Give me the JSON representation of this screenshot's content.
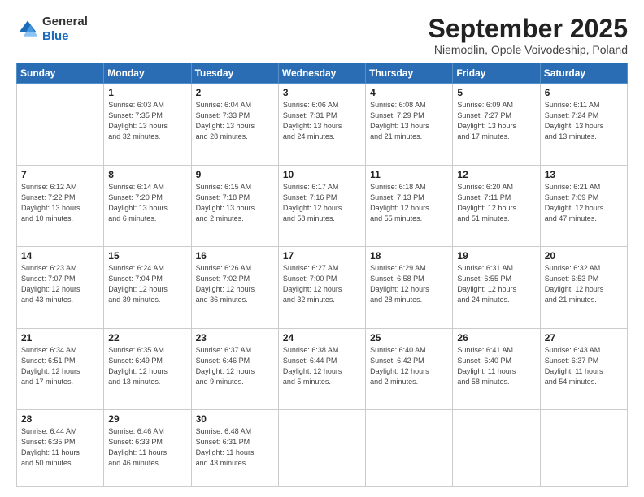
{
  "logo": {
    "general": "General",
    "blue": "Blue"
  },
  "header": {
    "month": "September 2025",
    "location": "Niemodlin, Opole Voivodeship, Poland"
  },
  "weekdays": [
    "Sunday",
    "Monday",
    "Tuesday",
    "Wednesday",
    "Thursday",
    "Friday",
    "Saturday"
  ],
  "weeks": [
    [
      {
        "day": "",
        "info": ""
      },
      {
        "day": "1",
        "info": "Sunrise: 6:03 AM\nSunset: 7:35 PM\nDaylight: 13 hours\nand 32 minutes."
      },
      {
        "day": "2",
        "info": "Sunrise: 6:04 AM\nSunset: 7:33 PM\nDaylight: 13 hours\nand 28 minutes."
      },
      {
        "day": "3",
        "info": "Sunrise: 6:06 AM\nSunset: 7:31 PM\nDaylight: 13 hours\nand 24 minutes."
      },
      {
        "day": "4",
        "info": "Sunrise: 6:08 AM\nSunset: 7:29 PM\nDaylight: 13 hours\nand 21 minutes."
      },
      {
        "day": "5",
        "info": "Sunrise: 6:09 AM\nSunset: 7:27 PM\nDaylight: 13 hours\nand 17 minutes."
      },
      {
        "day": "6",
        "info": "Sunrise: 6:11 AM\nSunset: 7:24 PM\nDaylight: 13 hours\nand 13 minutes."
      }
    ],
    [
      {
        "day": "7",
        "info": "Sunrise: 6:12 AM\nSunset: 7:22 PM\nDaylight: 13 hours\nand 10 minutes."
      },
      {
        "day": "8",
        "info": "Sunrise: 6:14 AM\nSunset: 7:20 PM\nDaylight: 13 hours\nand 6 minutes."
      },
      {
        "day": "9",
        "info": "Sunrise: 6:15 AM\nSunset: 7:18 PM\nDaylight: 13 hours\nand 2 minutes."
      },
      {
        "day": "10",
        "info": "Sunrise: 6:17 AM\nSunset: 7:16 PM\nDaylight: 12 hours\nand 58 minutes."
      },
      {
        "day": "11",
        "info": "Sunrise: 6:18 AM\nSunset: 7:13 PM\nDaylight: 12 hours\nand 55 minutes."
      },
      {
        "day": "12",
        "info": "Sunrise: 6:20 AM\nSunset: 7:11 PM\nDaylight: 12 hours\nand 51 minutes."
      },
      {
        "day": "13",
        "info": "Sunrise: 6:21 AM\nSunset: 7:09 PM\nDaylight: 12 hours\nand 47 minutes."
      }
    ],
    [
      {
        "day": "14",
        "info": "Sunrise: 6:23 AM\nSunset: 7:07 PM\nDaylight: 12 hours\nand 43 minutes."
      },
      {
        "day": "15",
        "info": "Sunrise: 6:24 AM\nSunset: 7:04 PM\nDaylight: 12 hours\nand 39 minutes."
      },
      {
        "day": "16",
        "info": "Sunrise: 6:26 AM\nSunset: 7:02 PM\nDaylight: 12 hours\nand 36 minutes."
      },
      {
        "day": "17",
        "info": "Sunrise: 6:27 AM\nSunset: 7:00 PM\nDaylight: 12 hours\nand 32 minutes."
      },
      {
        "day": "18",
        "info": "Sunrise: 6:29 AM\nSunset: 6:58 PM\nDaylight: 12 hours\nand 28 minutes."
      },
      {
        "day": "19",
        "info": "Sunrise: 6:31 AM\nSunset: 6:55 PM\nDaylight: 12 hours\nand 24 minutes."
      },
      {
        "day": "20",
        "info": "Sunrise: 6:32 AM\nSunset: 6:53 PM\nDaylight: 12 hours\nand 21 minutes."
      }
    ],
    [
      {
        "day": "21",
        "info": "Sunrise: 6:34 AM\nSunset: 6:51 PM\nDaylight: 12 hours\nand 17 minutes."
      },
      {
        "day": "22",
        "info": "Sunrise: 6:35 AM\nSunset: 6:49 PM\nDaylight: 12 hours\nand 13 minutes."
      },
      {
        "day": "23",
        "info": "Sunrise: 6:37 AM\nSunset: 6:46 PM\nDaylight: 12 hours\nand 9 minutes."
      },
      {
        "day": "24",
        "info": "Sunrise: 6:38 AM\nSunset: 6:44 PM\nDaylight: 12 hours\nand 5 minutes."
      },
      {
        "day": "25",
        "info": "Sunrise: 6:40 AM\nSunset: 6:42 PM\nDaylight: 12 hours\nand 2 minutes."
      },
      {
        "day": "26",
        "info": "Sunrise: 6:41 AM\nSunset: 6:40 PM\nDaylight: 11 hours\nand 58 minutes."
      },
      {
        "day": "27",
        "info": "Sunrise: 6:43 AM\nSunset: 6:37 PM\nDaylight: 11 hours\nand 54 minutes."
      }
    ],
    [
      {
        "day": "28",
        "info": "Sunrise: 6:44 AM\nSunset: 6:35 PM\nDaylight: 11 hours\nand 50 minutes."
      },
      {
        "day": "29",
        "info": "Sunrise: 6:46 AM\nSunset: 6:33 PM\nDaylight: 11 hours\nand 46 minutes."
      },
      {
        "day": "30",
        "info": "Sunrise: 6:48 AM\nSunset: 6:31 PM\nDaylight: 11 hours\nand 43 minutes."
      },
      {
        "day": "",
        "info": ""
      },
      {
        "day": "",
        "info": ""
      },
      {
        "day": "",
        "info": ""
      },
      {
        "day": "",
        "info": ""
      }
    ]
  ]
}
